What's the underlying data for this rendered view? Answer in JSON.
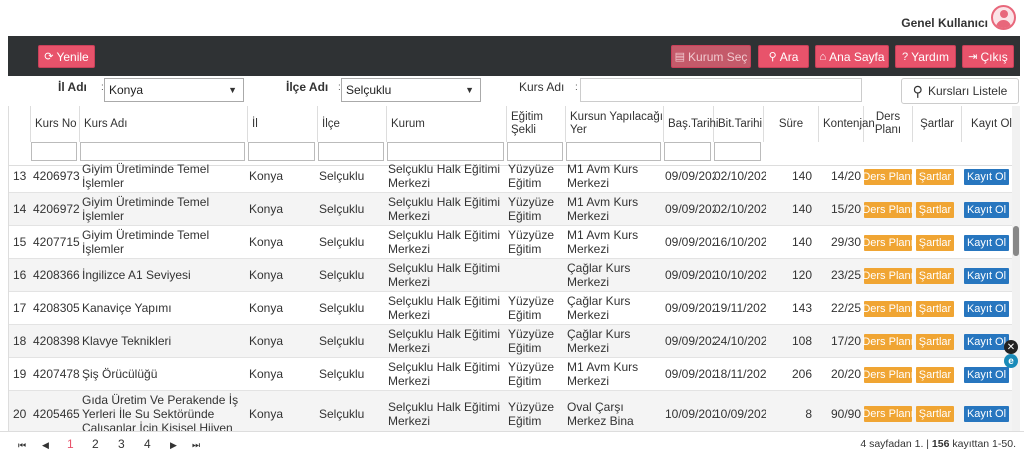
{
  "user": {
    "name": "Genel Kullanıcı"
  },
  "toolbar": {
    "refresh": "Yenile",
    "kurum_sec": "Kurum Seç",
    "ara": "Ara",
    "ana_sayfa": "Ana Sayfa",
    "yardim": "Yardım",
    "cikis": "Çıkış"
  },
  "filters": {
    "il_label": "İl Adı",
    "il_value": "Konya",
    "ilce_label": "İlçe Adı",
    "ilce_value": "Selçuklu",
    "kurs_label": "Kurs Adı",
    "kurs_value": "",
    "list_button": "Kursları Listele"
  },
  "columns": {
    "kurs_no": "Kurs No",
    "kurs_adi": "Kurs Adı",
    "il": "İl",
    "ilce": "İlçe",
    "kurum": "Kurum",
    "egitim_sekli": "Eğitim Şekli",
    "yer": "Kursun Yapılacağı Yer",
    "bas_tarihi": "Baş.Tarihi",
    "bit_tarihi": "Bit.Tarihi",
    "sure": "Süre",
    "kontenjan": "Kontenjan",
    "ders_plani": "Ders Planı",
    "sartlar": "Şartlar",
    "kayit": "Kayıt Ol"
  },
  "rows": [
    {
      "idx": "13",
      "no": "4206973",
      "ad": "Giyim Üretiminde Temel İşlemler",
      "il": "Konya",
      "ilce": "Selçuklu",
      "kurum": "Selçuklu Halk Eğitimi Merkezi",
      "sekil": "Yüzyüze Eğitim",
      "yer": "M1 Avm Kurs Merkezi",
      "bas": "09/09/202",
      "bit": "02/10/202",
      "sure": "140",
      "kont": "14/20"
    },
    {
      "idx": "14",
      "no": "4206972",
      "ad": "Giyim Üretiminde Temel İşlemler",
      "il": "Konya",
      "ilce": "Selçuklu",
      "kurum": "Selçuklu Halk Eğitimi Merkezi",
      "sekil": "Yüzyüze Eğitim",
      "yer": "M1 Avm Kurs Merkezi",
      "bas": "09/09/202",
      "bit": "02/10/202",
      "sure": "140",
      "kont": "15/20"
    },
    {
      "idx": "15",
      "no": "4207715",
      "ad": "Giyim Üretiminde Temel İşlemler",
      "il": "Konya",
      "ilce": "Selçuklu",
      "kurum": "Selçuklu Halk Eğitimi Merkezi",
      "sekil": "Yüzyüze Eğitim",
      "yer": "M1 Avm Kurs Merkezi",
      "bas": "09/09/202",
      "bit": "16/10/202",
      "sure": "140",
      "kont": "29/30"
    },
    {
      "idx": "16",
      "no": "4208366",
      "ad": "İngilizce A1 Seviyesi",
      "il": "Konya",
      "ilce": "Selçuklu",
      "kurum": "Selçuklu Halk Eğitimi Merkezi",
      "sekil": "",
      "yer": "Çağlar Kurs Merkezi",
      "bas": "09/09/202",
      "bit": "10/10/202",
      "sure": "120",
      "kont": "23/25"
    },
    {
      "idx": "17",
      "no": "4208305",
      "ad": "Kanaviçe Yapımı",
      "il": "Konya",
      "ilce": "Selçuklu",
      "kurum": "Selçuklu Halk Eğitimi Merkezi",
      "sekil": "Yüzyüze Eğitim",
      "yer": "Çağlar Kurs Merkezi",
      "bas": "09/09/202",
      "bit": "19/11/202",
      "sure": "143",
      "kont": "22/25"
    },
    {
      "idx": "18",
      "no": "4208398",
      "ad": "Klavye Teknikleri",
      "il": "Konya",
      "ilce": "Selçuklu",
      "kurum": "Selçuklu Halk Eğitimi Merkezi",
      "sekil": "Yüzyüze Eğitim",
      "yer": "Çağlar Kurs Merkezi",
      "bas": "09/09/202",
      "bit": "24/10/202",
      "sure": "108",
      "kont": "17/20"
    },
    {
      "idx": "19",
      "no": "4207478",
      "ad": "Şiş Örücülüğü",
      "il": "Konya",
      "ilce": "Selçuklu",
      "kurum": "Selçuklu Halk Eğitimi Merkezi",
      "sekil": "Yüzyüze Eğitim",
      "yer": "M1 Avm Kurs Merkezi",
      "bas": "09/09/202",
      "bit": "18/11/202",
      "sure": "206",
      "kont": "20/20"
    },
    {
      "idx": "20",
      "no": "4205465",
      "ad": "Gıda Üretim Ve Perakende İş Yerleri İle Su Sektöründe Çalışanlar İçin Kişisel Hijyen",
      "il": "Konya",
      "ilce": "Selçuklu",
      "kurum": "Selçuklu Halk Eğitimi Merkezi",
      "sekil": "Yüzyüze Eğitim",
      "yer": "Oval Çarşı Merkez Bina",
      "bas": "10/09/202",
      "bit": "10/09/202",
      "sure": "8",
      "kont": "90/90"
    }
  ],
  "row_buttons": {
    "ders_plani": "Ders Planı",
    "sartlar": "Şartlar",
    "kayit": "Kayıt Ol"
  },
  "pager": {
    "first": "⏮",
    "prev": "◀",
    "next": "▶",
    "last": "⏭",
    "pages": [
      "1",
      "2",
      "3",
      "4"
    ],
    "active_page": "1",
    "info_prefix": "4 sayfadan 1. | ",
    "info_count": "156",
    "info_suffix": " kayıttan 1-50."
  },
  "colors": {
    "accent": "#e8536b",
    "orange": "#f0a533",
    "blue": "#2776bf",
    "toolbar_bg": "#2f3234"
  }
}
